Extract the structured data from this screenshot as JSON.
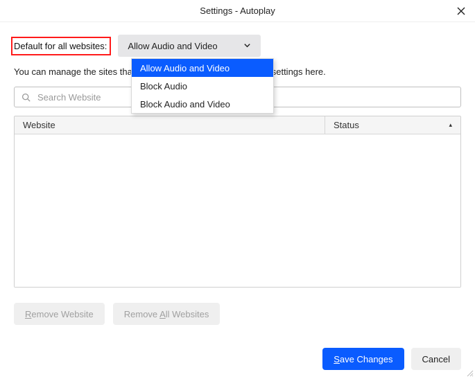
{
  "window": {
    "title": "Settings - Autoplay"
  },
  "default_label": "Default for all websites:",
  "dropdown": {
    "selected": "Allow Audio and Video",
    "options": [
      "Allow Audio and Video",
      "Block Audio",
      "Block Audio and Video"
    ]
  },
  "description": "You can manage the sites that do not follow the default autoplay settings here.",
  "search_placeholder": "Search Website",
  "table": {
    "columns": {
      "website": "Website",
      "status": "Status"
    },
    "sort_indicator": "▴",
    "rows": []
  },
  "buttons": {
    "remove_website": {
      "mnemonic": "R",
      "rest": "emove Website"
    },
    "remove_all": {
      "prefix": "Remove ",
      "mnemonic": "A",
      "rest": "ll Websites"
    },
    "save": {
      "mnemonic": "S",
      "rest": "ave Changes"
    },
    "cancel": "Cancel"
  }
}
